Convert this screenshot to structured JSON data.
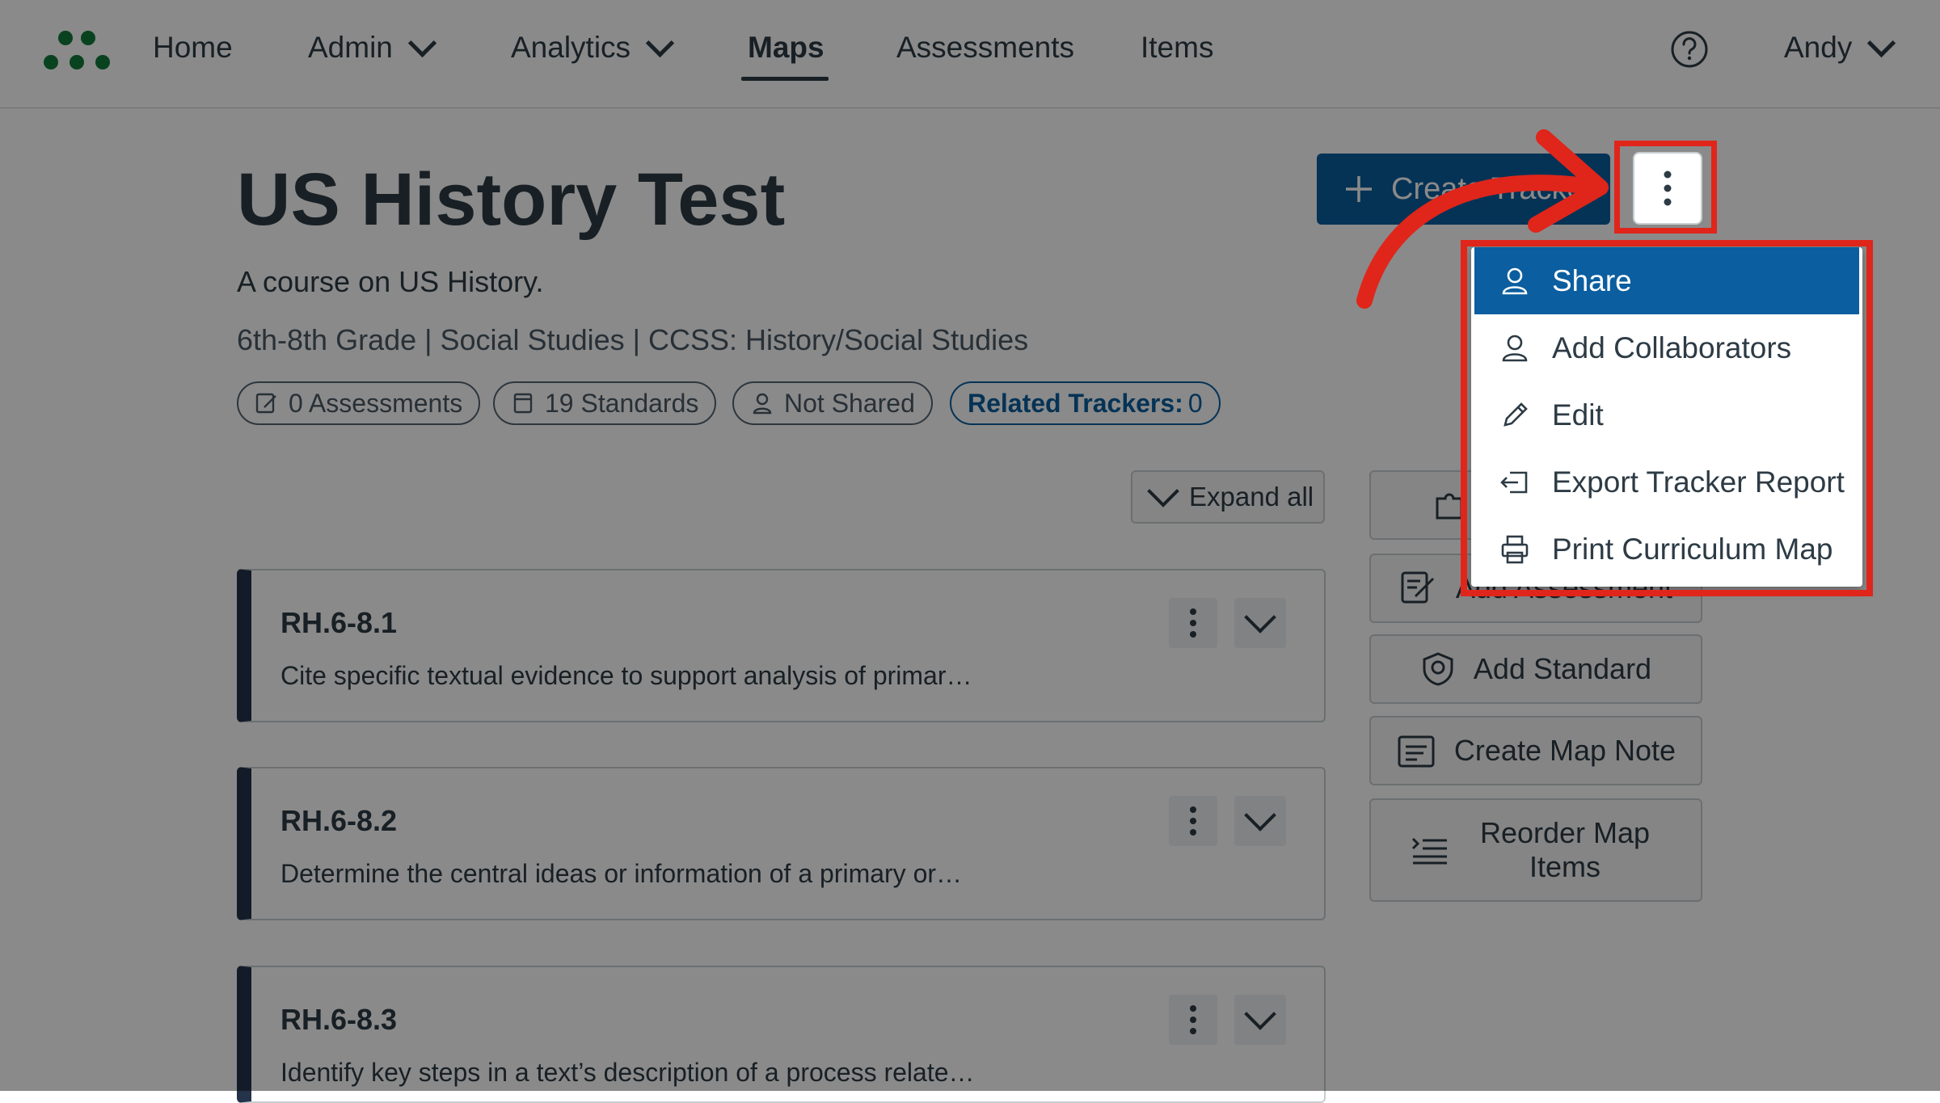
{
  "nav": {
    "home": "Home",
    "admin": "Admin",
    "analytics": "Analytics",
    "maps": "Maps",
    "assessments": "Assessments",
    "items": "Items",
    "user": "Andy"
  },
  "header": {
    "title": "US History Test",
    "description": "A course on US History.",
    "meta": "6th-8th Grade | Social Studies | CCSS: History/Social Studies",
    "pills": {
      "assessments": "0 Assessments",
      "standards": "19 Standards",
      "sharing": "Not Shared",
      "related_label": "Related Trackers:",
      "related_count": "0"
    },
    "create_tracker": "Create Tracker"
  },
  "toolbar": {
    "expand_all": "Expand all"
  },
  "standards": [
    {
      "code": "RH.6-8.1",
      "description": "Cite specific textual evidence to support analysis of primar…"
    },
    {
      "code": "RH.6-8.2",
      "description": "Determine the central ideas or information of a primary or…"
    },
    {
      "code": "RH.6-8.3",
      "description": "Identify key steps in a text’s description of a process relate…"
    }
  ],
  "side_actions": {
    "add_assessment": "Add Assessment",
    "add_standard": "Add Standard",
    "create_map_note": "Create Map Note",
    "reorder": "Reorder Map Items"
  },
  "menu": {
    "items": [
      "Share",
      "Add Collaborators",
      "Edit",
      "Export Tracker Report",
      "Print Curriculum Map"
    ]
  },
  "colors": {
    "accent": "#0b5e9f",
    "highlight": "#e0251b",
    "brand": "#127a3a"
  }
}
